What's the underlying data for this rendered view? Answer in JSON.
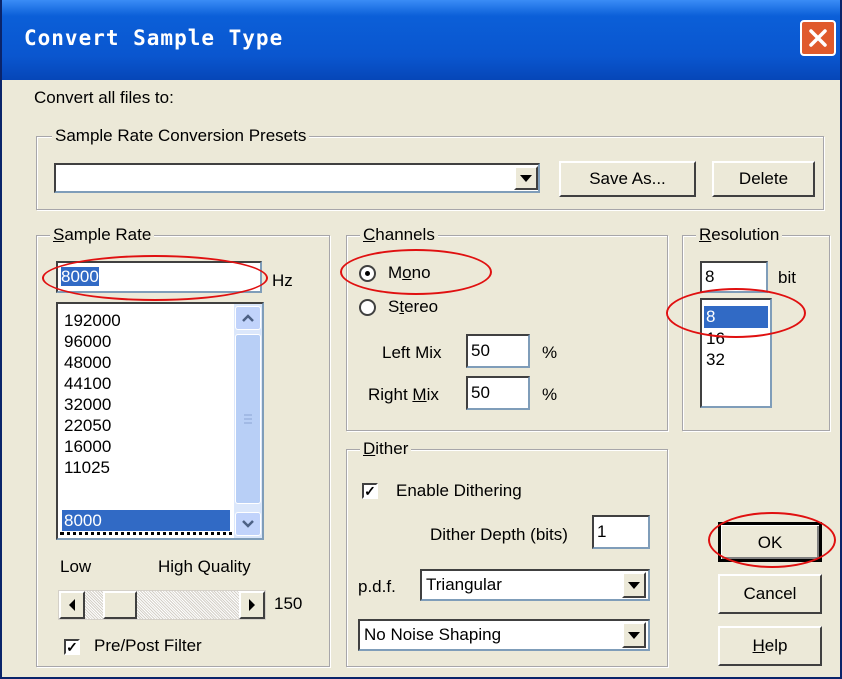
{
  "window": {
    "title": "Convert Sample Type"
  },
  "intro": "Convert all files to:",
  "presets": {
    "group_label": "Sample Rate Conversion Presets",
    "value": "",
    "save_as": "Save As...",
    "delete": "Delete"
  },
  "sample_rate": {
    "group_label_u": "S",
    "group_label_rest": "ample Rate",
    "value": "8000",
    "unit": "Hz",
    "options": [
      "192000",
      "96000",
      "48000",
      "44100",
      "32000",
      "22050",
      "16000",
      "11025",
      "8000"
    ],
    "selected": "8000",
    "quality_low": "Low",
    "quality_high": "High Quality",
    "quality_value": "150",
    "prepost_filter": "Pre/Post Filter"
  },
  "channels": {
    "group_label_u": "C",
    "group_label_rest": "hannels",
    "mono_pre": "M",
    "mono_u": "o",
    "mono_post": "no",
    "stereo_pre": "S",
    "stereo_u": "t",
    "stereo_post": "ereo",
    "selected": "Mono",
    "left_mix_label": "Left Mix",
    "left_mix": "50",
    "left_unit": "%",
    "right_mix_pre": "Right ",
    "right_mix_u": "M",
    "right_mix_post": "ix",
    "right_mix": "50",
    "right_unit": "%"
  },
  "resolution": {
    "group_label_u": "R",
    "group_label_rest": "esolution",
    "value": "8",
    "unit": "bit",
    "options": [
      "8",
      "16",
      "32"
    ],
    "selected": "8"
  },
  "dither": {
    "group_label_u": "D",
    "group_label_rest": "ither",
    "enable_label": "Enable Dithering",
    "depth_label": "Dither Depth (bits)",
    "depth": "1",
    "pdf_label": "p.d.f.",
    "pdf": "Triangular",
    "noise_shaping": "No Noise Shaping"
  },
  "buttons": {
    "ok": "OK",
    "cancel": "Cancel",
    "help_u": "H",
    "help_rest": "elp"
  },
  "colors": {
    "title_blue": "#0a56cf",
    "selection": "#316ac5",
    "annotation": "#e01010",
    "face": "#ece9d8"
  }
}
